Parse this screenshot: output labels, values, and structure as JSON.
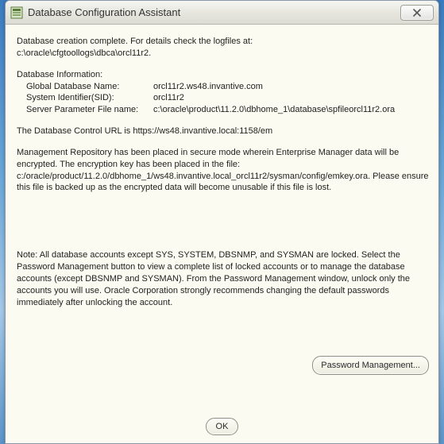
{
  "window": {
    "title": "Database Configuration Assistant"
  },
  "content": {
    "creation_complete": "Database creation complete. For details check the logfiles at:",
    "logfiles_path": " c:\\oracle\\cfgtoollogs\\dbca\\orcl11r2.",
    "db_info_heading": "Database Information:",
    "global_db_name_label": "Global Database Name:",
    "global_db_name_value": "orcl11r2.ws48.invantive.com",
    "sid_label": "System Identifier(SID):",
    "sid_value": "orcl11r2",
    "spfile_label": "Server Parameter File name:",
    "spfile_value": "c:\\oracle\\product\\11.2.0\\dbhome_1\\database\\spfileorcl11r2.ora",
    "control_url_line": "The Database Control URL is https://ws48.invantive.local:1158/em",
    "repo_line": "Management Repository has been placed in secure mode wherein Enterprise Manager data will be encrypted.  The encryption key has been placed in the file: c:/oracle/product/11.2.0/dbhome_1/ws48.invantive.local_orcl11r2/sysman/config/emkey.ora.   Please ensure this file is backed up as the encrypted data will become unusable if this file is lost.",
    "note_line": "Note: All database accounts except SYS, SYSTEM, DBSNMP, and SYSMAN are locked. Select the Password Management button to view a complete list of locked accounts or to manage the database accounts (except DBSNMP and SYSMAN). From the Password Management window, unlock only the accounts you will use. Oracle Corporation strongly recommends changing the default passwords immediately after unlocking the account."
  },
  "buttons": {
    "password_management": "Password Management...",
    "ok": "OK"
  }
}
